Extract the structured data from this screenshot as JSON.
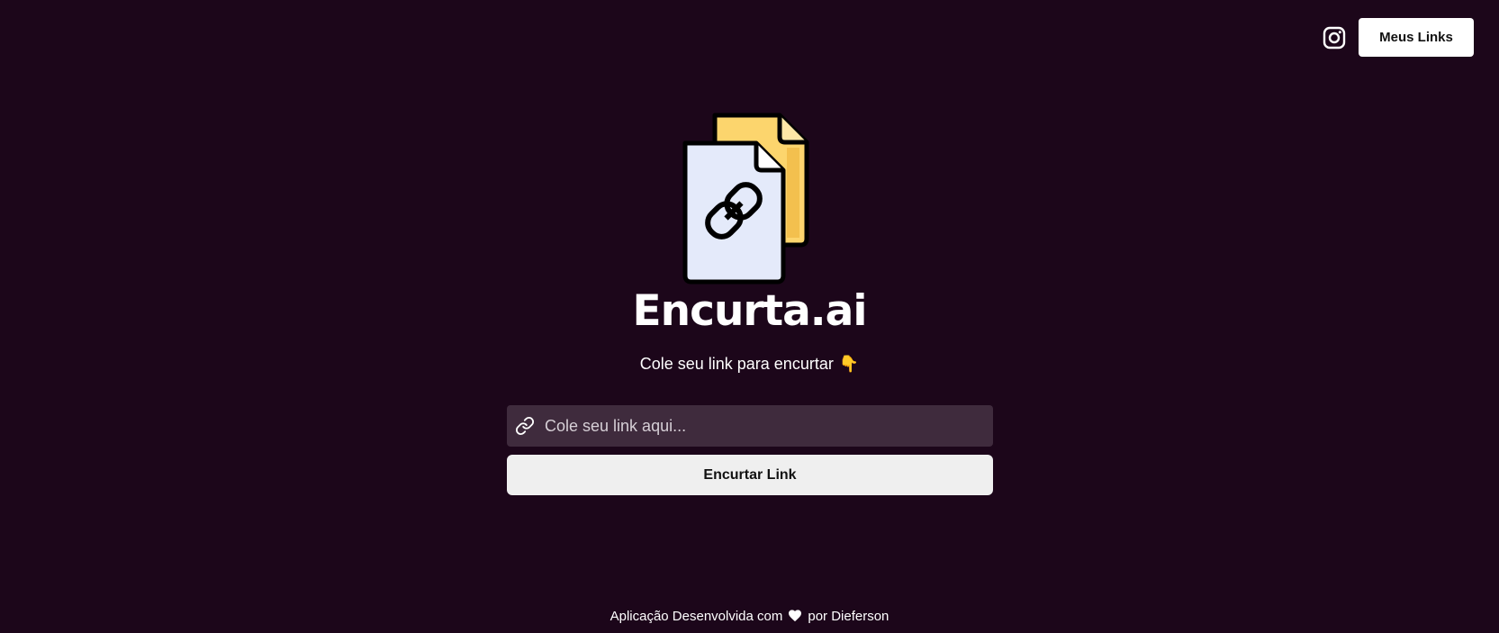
{
  "header": {
    "instagram_icon": "instagram-icon",
    "my_links_label": "Meus Links"
  },
  "hero": {
    "logo_icon": "document-link-logo",
    "title": "Encurta.ai",
    "subtitle": "Cole seu link para encurtar",
    "subtitle_emoji": "👇"
  },
  "form": {
    "input_icon": "link-icon",
    "input_placeholder": "Cole seu link aqui...",
    "input_value": "",
    "submit_label": "Encurtar Link"
  },
  "footer": {
    "text_before": "Aplicação Desenvolvida com",
    "heart_icon": "heart-icon",
    "text_after": "por Dieferson"
  },
  "colors": {
    "background": "#1c061a",
    "input_background": "#3f2b3d",
    "logo_yellow": "#fcd56d",
    "logo_blue": "#e4eafa"
  }
}
